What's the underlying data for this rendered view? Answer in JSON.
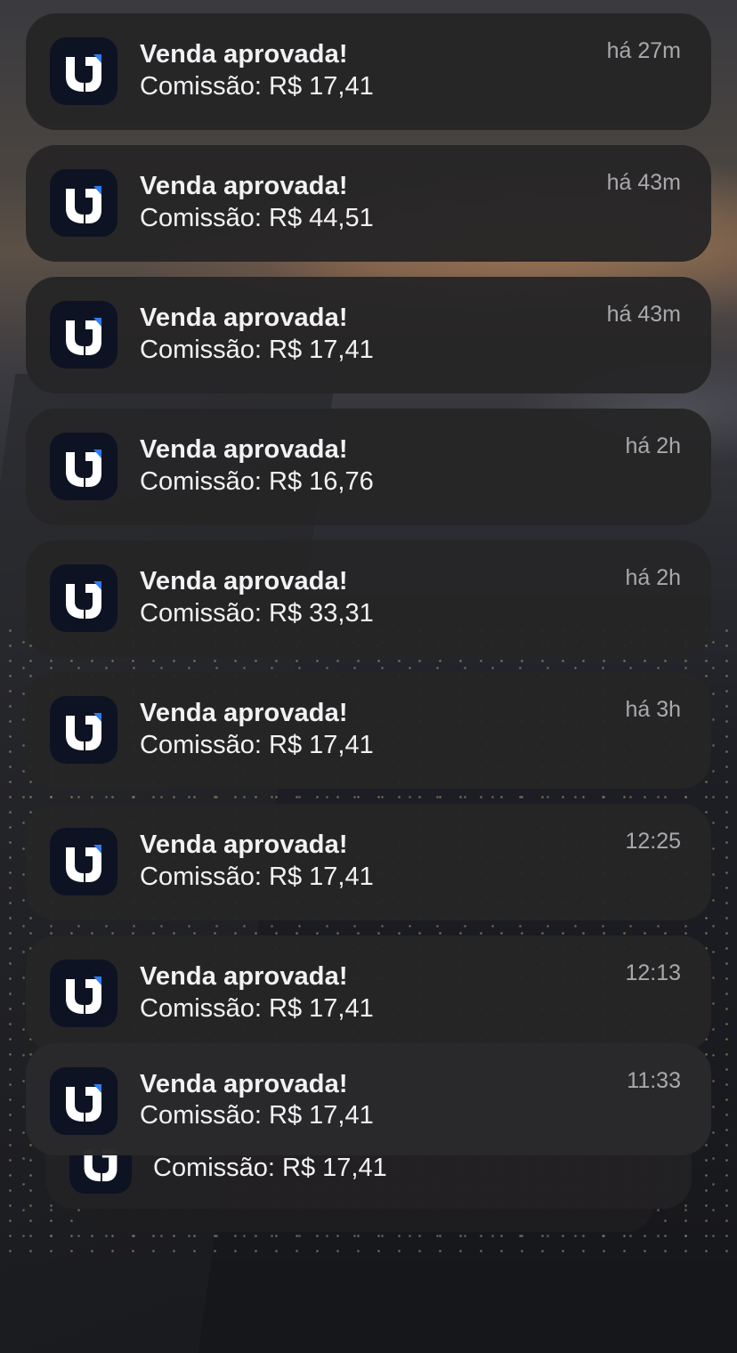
{
  "notifications": [
    {
      "title": "Venda aprovada!",
      "body": "Comissão: R$ 17,41",
      "time": "há 27m"
    },
    {
      "title": "Venda aprovada!",
      "body": "Comissão: R$ 44,51",
      "time": "há 43m"
    },
    {
      "title": "Venda aprovada!",
      "body": "Comissão: R$ 17,41",
      "time": "há 43m"
    },
    {
      "title": "Venda aprovada!",
      "body": "Comissão: R$ 16,76",
      "time": "há 2h"
    },
    {
      "title": "Venda aprovada!",
      "body": "Comissão: R$ 33,31",
      "time": "há 2h"
    },
    {
      "title": "Venda aprovada!",
      "body": "Comissão: R$ 17,41",
      "time": "há 3h"
    },
    {
      "title": "Venda aprovada!",
      "body": "Comissão: R$ 17,41",
      "time": "12:25"
    },
    {
      "title": "Venda aprovada!",
      "body": "Comissão: R$ 17,41",
      "time": "12:13"
    },
    {
      "title": "Venda aprovada!",
      "body": "Comissão: R$ 17,41",
      "time": "11:33"
    }
  ],
  "stacked_preview": {
    "body": "Comissão: R$ 17,41"
  },
  "app_icon": {
    "name": "app-logo-icon",
    "background": "#0d1322",
    "accent": "#2f7bf0",
    "glyph": "#ffffff"
  }
}
